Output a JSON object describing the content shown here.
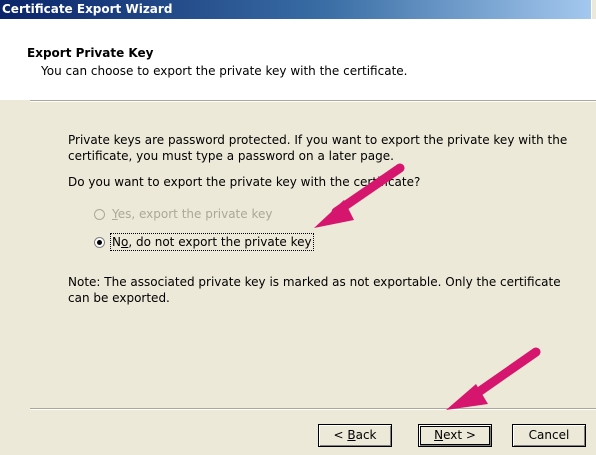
{
  "window": {
    "title": "Certificate Export Wizard"
  },
  "header": {
    "title": "Export Private Key",
    "subtitle": "You can choose to export the private key with the certificate."
  },
  "body": {
    "paragraph1_line1": "Private keys are password protected. If you want to export the private key with the",
    "paragraph1_line2": "certificate, you must type a password on a later page.",
    "question": "Do you want to export the private key with the certificate?",
    "options": [
      {
        "label_accel": "Y",
        "label_rest": "es, export the private key",
        "selected": false,
        "enabled": false
      },
      {
        "label_accel": "o",
        "label_prefix": "N",
        "label_rest": ", do not export the private key",
        "selected": true,
        "enabled": true
      }
    ],
    "note_line1": "Note: The associated private key is marked as not exportable. Only the certificate",
    "note_line2": "can be exported."
  },
  "buttons": {
    "back": {
      "prefix": "< ",
      "accel": "B",
      "rest": "ack"
    },
    "next": {
      "accel": "N",
      "rest": "ext >"
    },
    "cancel": "Cancel"
  },
  "colors": {
    "arrow": "#d6166e",
    "titlebar": "#0a246a"
  }
}
